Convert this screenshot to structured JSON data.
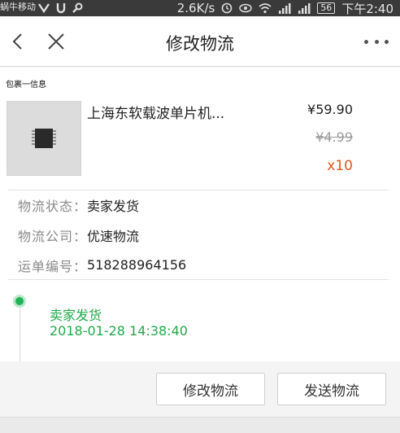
{
  "status_bar": {
    "carrier": "蜗牛移动",
    "speed": "2.6K/s",
    "battery": "56",
    "time": "下午2:40"
  },
  "header": {
    "title": "修改物流"
  },
  "package": {
    "section_title": "包裹一信息",
    "product_name": "上海东软载波单片机...",
    "price": "¥59.90",
    "original_price": "¥4.99",
    "quantity": "x10"
  },
  "info": {
    "rows": [
      {
        "label": "物流状态：",
        "value": "卖家发货"
      },
      {
        "label": "物流公司：",
        "value": "优速物流"
      },
      {
        "label": "运单编号：",
        "value": "518288964156"
      }
    ]
  },
  "timeline": {
    "entries": [
      {
        "status": "卖家发货",
        "time": "2018-01-28 14:38:40"
      }
    ]
  },
  "actions": {
    "modify_label": "修改物流",
    "send_label": "发送物流"
  },
  "colors": {
    "accent_green": "#22a84b",
    "quantity_orange": "#e2561a"
  }
}
